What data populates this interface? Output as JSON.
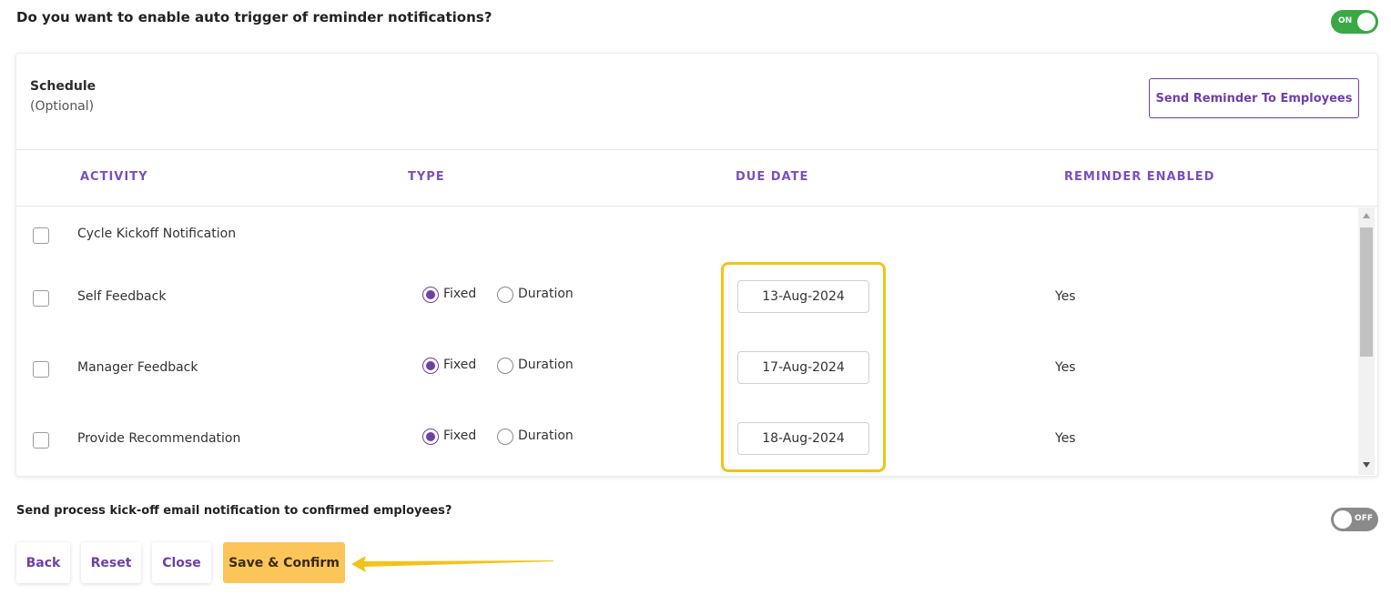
{
  "auto_trigger": {
    "question": "Do you want to enable auto trigger of reminder notifications?",
    "toggle_label": "ON"
  },
  "schedule": {
    "title": "Schedule",
    "subtitle": "(Optional)",
    "send_reminder_button": "Send Reminder To Employees"
  },
  "table": {
    "headers": {
      "activity": "ACTIVITY",
      "type": "TYPE",
      "due_date": "DUE DATE",
      "reminder": "REMINDER ENABLED"
    },
    "rows": [
      {
        "activity": "Cycle Kickoff Notification",
        "type_options": [],
        "due_date": "",
        "reminder": ""
      },
      {
        "activity": "Self Feedback",
        "type_options": [
          "Fixed",
          "Duration"
        ],
        "selected_type": "Fixed",
        "due_date": "13-Aug-2024",
        "reminder": "Yes"
      },
      {
        "activity": "Manager Feedback",
        "type_options": [
          "Fixed",
          "Duration"
        ],
        "selected_type": "Fixed",
        "due_date": "17-Aug-2024",
        "reminder": "Yes"
      },
      {
        "activity": "Provide Recommendation",
        "type_options": [
          "Fixed",
          "Duration"
        ],
        "selected_type": "Fixed",
        "due_date": "18-Aug-2024",
        "reminder": "Yes"
      }
    ]
  },
  "kickoff": {
    "question": "Send process kick-off email notification to confirmed employees?",
    "toggle_label": "OFF"
  },
  "footer": {
    "back": "Back",
    "reset": "Reset",
    "close": "Close",
    "save": "Save & Confirm"
  },
  "colors": {
    "accent": "#6e3fa8",
    "toggle_on": "#3aa845",
    "toggle_off": "#8a8a8a",
    "highlight": "#f3c319",
    "save_button": "#fcc55a"
  }
}
